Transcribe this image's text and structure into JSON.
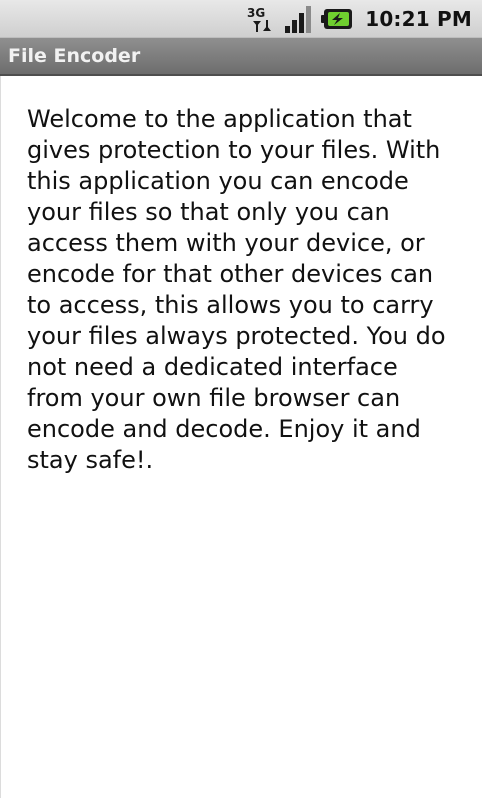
{
  "status_bar": {
    "network_type": "3G",
    "time": "10:21 PM",
    "icons": [
      "3g-data-icon",
      "signal-strength-icon",
      "battery-charging-icon"
    ]
  },
  "app_bar": {
    "title": "File Encoder"
  },
  "main": {
    "welcome_text": "Welcome to the application that gives protection to your files. With this application you can encode your files so that only you can access them with your device, or encode for that other devices can to access, this allows you to carry your files always protected. You do not need a dedicated interface from your own file browser can encode and decode. Enjoy it and stay safe!."
  },
  "colors": {
    "status_bar_bg": "#d9d9d9",
    "title_bar_bg": "#7d7d7d",
    "title_text": "#f2f2f2",
    "body_text": "#111111",
    "battery_green": "#6fcf2f"
  }
}
